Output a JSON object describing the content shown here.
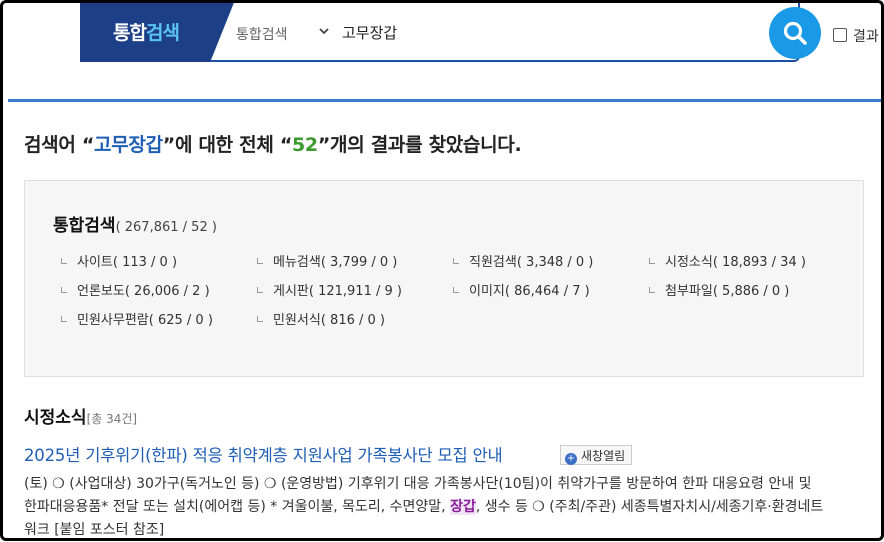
{
  "header": {
    "brand_part1": "통합",
    "brand_part2": "검색",
    "scope": "통합검색",
    "query": "고무장갑",
    "checkbox_label": "결과"
  },
  "headline": {
    "prefix": "검색어 “",
    "keyword": "고무장갑",
    "middle": "”에 대한 전체 “",
    "count": "52",
    "suffix": "”개의 결과를 찾았습니다."
  },
  "summary": {
    "title": "통합검색",
    "count": "( 267,861 / 52 )",
    "categories": [
      {
        "label": "사이트( 113 / 0 )"
      },
      {
        "label": "메뉴검색( 3,799 / 0 )"
      },
      {
        "label": "직원검색( 3,348 / 0 )"
      },
      {
        "label": "시정소식( 18,893 / 34 )"
      },
      {
        "label": "언론보도( 26,006 / 2 )"
      },
      {
        "label": "게시판( 121,911 / 9 )"
      },
      {
        "label": "이미지( 86,464 / 7 )"
      },
      {
        "label": "첨부파일( 5,886 / 0 )"
      },
      {
        "label": "민원사무편람( 625 / 0 )"
      },
      {
        "label": "민원서식( 816 / 0 )"
      }
    ]
  },
  "section": {
    "title": "시정소식",
    "count": "[총 34건]"
  },
  "result": {
    "title": "2025년 기후위기(한파) 적응 취약계층 지원사업 가족봉사단 모집 안내",
    "new_window_label": "새창열림",
    "snippet_before": "(토) ❍ (사업대상) 30가구(독거노인 등) ❍ (운영방법) 기후위기 대응 가족봉사단(10팀)이 취약가구를 방문하여 한파 대응요령 안내 및 한파대응용품* 전달 또는 설치(에어캡 등) * 겨울이불, 목도리, 수면양말, ",
    "snippet_highlight": "장갑",
    "snippet_after": ", 생수 등 ❍ (주최/주관) 세종특별자치시/세종기후·환경네트워크 [붙임 포스터 참조]"
  }
}
